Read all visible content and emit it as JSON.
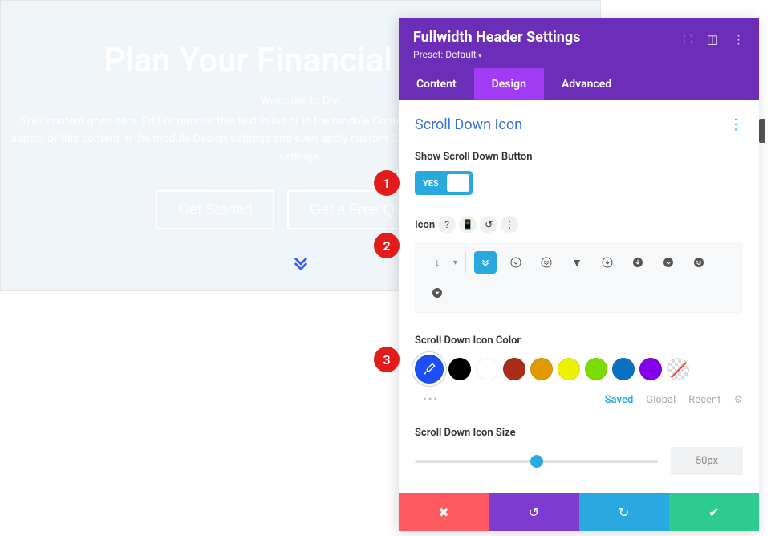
{
  "hero": {
    "title": "Plan Your Financial Future",
    "subtitle": "Welcome to Divi",
    "desc": "Your content goes here. Edit or remove this text inline or in the module Content settings. You can also style every aspect of this content in the module Design settings and even apply custom CSS to this text in the module Advanced settings.",
    "btn1": "Get Started",
    "btn2": "Get a Free Quote"
  },
  "panel": {
    "title": "Fullwidth Header Settings",
    "preset": "Preset: Default",
    "tabs": {
      "content": "Content",
      "design": "Design",
      "advanced": "Advanced"
    },
    "section": "Scroll Down Icon",
    "show_label": "Show Scroll Down Button",
    "toggle_yes": "YES",
    "icon_label": "Icon",
    "color_label": "Scroll Down Icon Color",
    "color_tabs": {
      "saved": "Saved",
      "global": "Global",
      "recent": "Recent"
    },
    "size_label": "Scroll Down Icon Size",
    "size_value": "50px",
    "swatches": [
      "#000000",
      "#ffffff",
      "#a92c17",
      "#e09900",
      "#edf000",
      "#7cdb00",
      "#0c71c3",
      "#8300e9"
    ]
  },
  "callouts": {
    "c1": "1",
    "c2": "2",
    "c3": "3"
  }
}
